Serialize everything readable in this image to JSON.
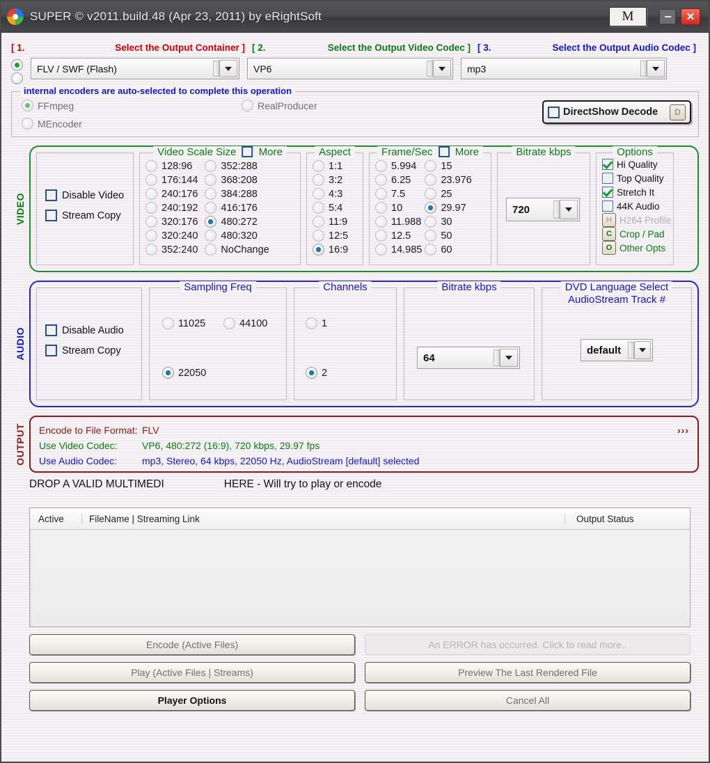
{
  "window": {
    "title": "SUPER © v2011.build.48 (Apr 23, 2011) by eRightSoft",
    "m_button": "M",
    "minimize": "–",
    "close": "✕"
  },
  "headers": [
    {
      "num": "[ 1.",
      "label": "Select the Output Container ]",
      "color": "#cc0000"
    },
    {
      "num": "[ 2.",
      "label": "Select the Output Video Codec ]",
      "color": "#0a7a17"
    },
    {
      "num": "[ 3.",
      "label": "Select the Output Audio Codec ]",
      "color": "#1414d2"
    }
  ],
  "selectors": {
    "container": "FLV / SWF (Flash)",
    "video_codec": "VP6",
    "audio_codec": "mp3"
  },
  "encoders": {
    "legend": "internal encoders are auto-selected to complete this operation",
    "options": [
      {
        "label": "FFmpeg",
        "selected": true
      },
      {
        "label": "RealProducer",
        "selected": false
      },
      {
        "label": "MEncoder",
        "selected": false
      }
    ],
    "directshow": {
      "label": "DirectShow Decode",
      "key": "D",
      "checked": false
    }
  },
  "video": {
    "section_label": "VIDEO",
    "toggles": [
      {
        "label": "Disable Video",
        "checked": false
      },
      {
        "label": "Stream Copy",
        "checked": false
      }
    ],
    "scale": {
      "legend": "Video Scale Size",
      "more_label": "More",
      "more_checked": false,
      "col1": [
        "128:96",
        "176:144",
        "240:176",
        "240:192",
        "320:176",
        "320:240",
        "352:240"
      ],
      "col2": [
        "352:288",
        "368:208",
        "384:288",
        "416:176",
        "480:272",
        "480:320",
        "NoChange"
      ],
      "selected": "480:272"
    },
    "aspect": {
      "legend": "Aspect",
      "items": [
        "1:1",
        "3:2",
        "4:3",
        "5:4",
        "11:9",
        "12:5",
        "16:9"
      ],
      "selected": "16:9"
    },
    "fps": {
      "legend": "Frame/Sec",
      "more_label": "More",
      "more_checked": false,
      "col1": [
        "5.994",
        "6.25",
        "7.5",
        "10",
        "11.988",
        "12.5",
        "14.985"
      ],
      "col2": [
        "15",
        "23.976",
        "25",
        "29.97",
        "30",
        "50",
        "60"
      ],
      "selected": "29.97"
    },
    "bitrate": {
      "legend": "Bitrate  kbps",
      "value": "720"
    },
    "options": {
      "legend": "Options",
      "items": [
        {
          "kind": "check",
          "label": "Hi Quality",
          "checked": true,
          "color": "#111111"
        },
        {
          "kind": "check",
          "label": "Top Quality",
          "checked": false,
          "color": "#111111"
        },
        {
          "kind": "check",
          "label": "Stretch It",
          "checked": true,
          "color": "#111111"
        },
        {
          "kind": "check",
          "label": "44K Audio",
          "checked": false,
          "color": "#111111"
        },
        {
          "kind": "button",
          "key": "H",
          "label": "H264 Profile",
          "color": "#b0b0b0"
        },
        {
          "kind": "button",
          "key": "C",
          "label": "Crop / Pad",
          "color": "#0a7a17"
        },
        {
          "kind": "button",
          "key": "O",
          "label": "Other Opts",
          "color": "#0a7a17"
        }
      ]
    }
  },
  "audio": {
    "section_label": "AUDIO",
    "toggles": [
      {
        "label": "Disable Audio",
        "checked": false
      },
      {
        "label": "Stream Copy",
        "checked": false
      }
    ],
    "sampling": {
      "legend": "Sampling Freq",
      "items": [
        "11025",
        "44100",
        "22050"
      ],
      "selected": "22050"
    },
    "channels": {
      "legend": "Channels",
      "items": [
        "1",
        "2"
      ],
      "selected": "2"
    },
    "bitrate": {
      "legend": "Bitrate  kbps",
      "value": "64"
    },
    "dvd": {
      "legend_line1": "DVD Language Select",
      "legend_line2": "AudioStream  Track #",
      "value": "default"
    }
  },
  "output": {
    "section_label": "OUTPUT",
    "arrows": "›››",
    "lines": [
      {
        "key": "Encode to File Format:",
        "value": "FLV",
        "color": "#8c1a14"
      },
      {
        "key": "Use Video Codec:",
        "value": "VP6,  480:272 (16:9),  720 kbps,  29.97 fps",
        "color": "#0a7a17"
      },
      {
        "key": "Use Audio Codec:",
        "value": "mp3,  Stereo,  64 kbps,  22050 Hz,  AudioStream [default] selected",
        "color": "#1414d2"
      }
    ]
  },
  "drop": {
    "left": "DROP A VALID MULTIMEDI",
    "right": "HERE - Will try to play or encode"
  },
  "filelist": {
    "columns": [
      "Active",
      "FileName  |  Streaming Link",
      "Output Status"
    ],
    "rows": []
  },
  "buttons": {
    "encode": "Encode (Active Files)",
    "error": "An ERROR has occurred. Click to read more..",
    "play": "Play (Active Files | Streams)",
    "preview": "Preview The Last Rendered File",
    "player_options": "Player Options",
    "cancel_all": "Cancel All"
  }
}
